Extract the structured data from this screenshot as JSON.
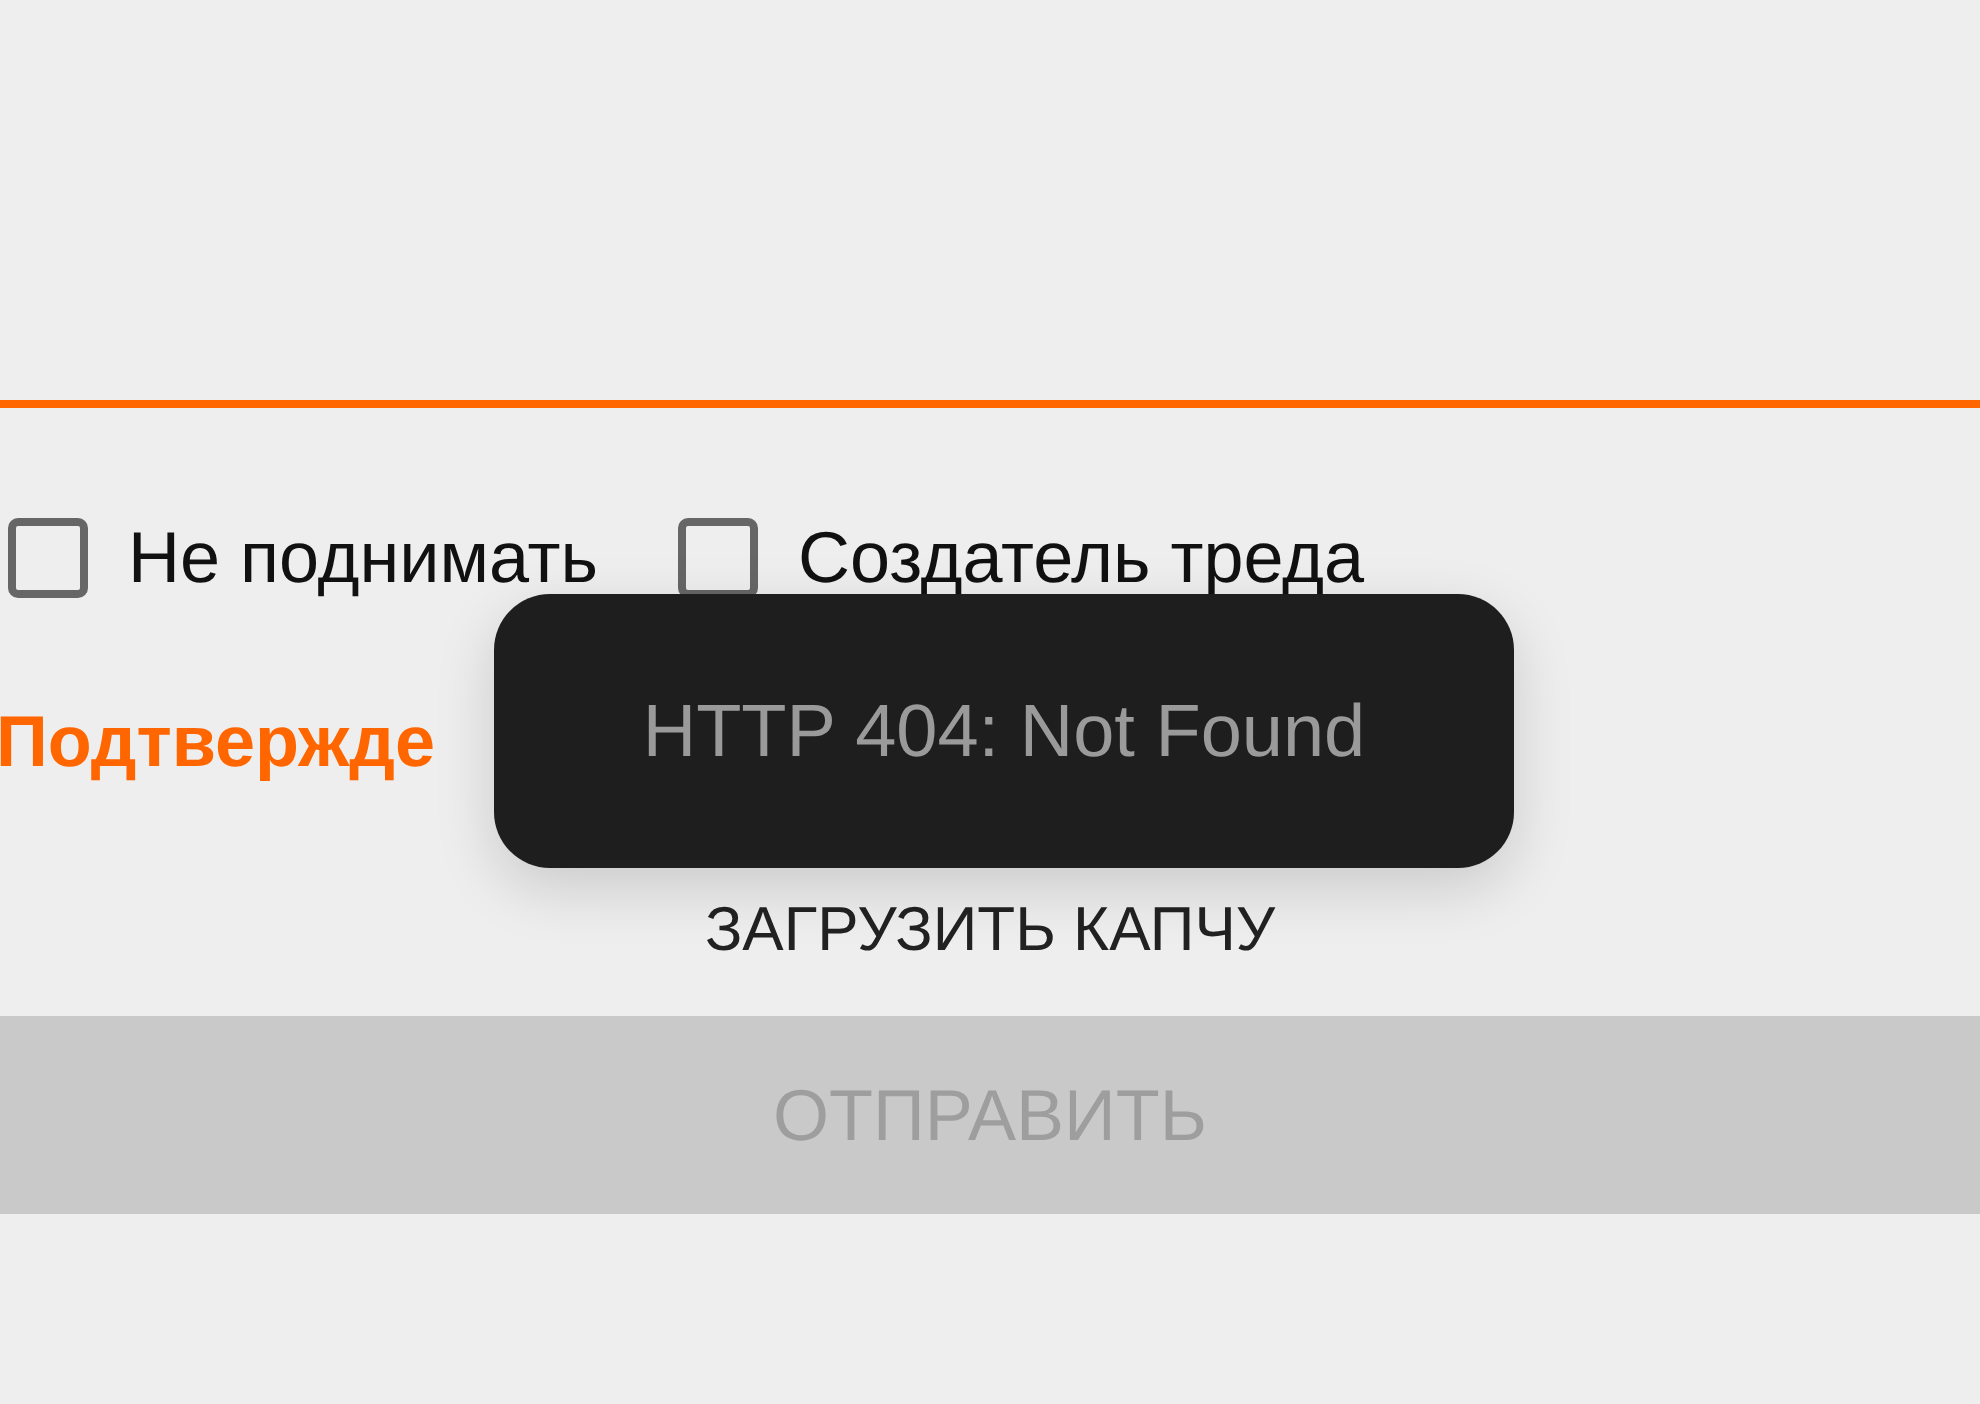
{
  "checkboxes": [
    {
      "label": "Не поднимать",
      "checked": false
    },
    {
      "label": "Создатель треда",
      "checked": false
    }
  ],
  "captcha_label": "Подтвержде",
  "captcha_button": "ЗАГРУЗИТЬ КАПЧУ",
  "submit_button": {
    "label": "ОТПРАВИТЬ",
    "disabled": true
  },
  "toast": "HTTP 404: Not Found"
}
